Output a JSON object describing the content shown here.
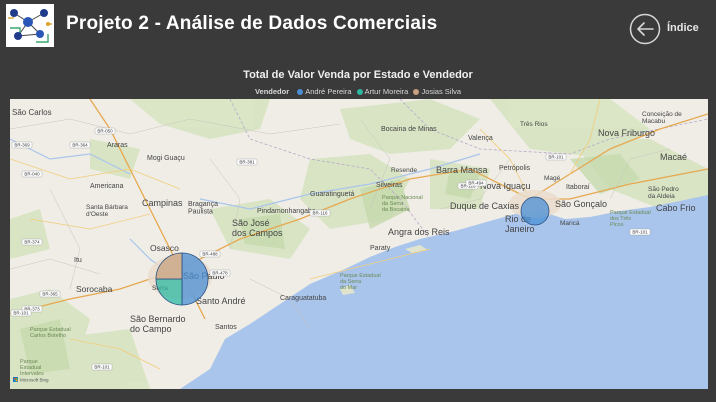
{
  "header": {
    "title": "Projeto 2 - Análise de Dados Comerciais",
    "back_label": "Índice"
  },
  "chart_data": {
    "type": "map",
    "title": "Total de Valor Venda por Estado e Vendedor",
    "legend_title": "Vendedor",
    "legend_placement": "top-center",
    "series": [
      {
        "name": "André Pereira",
        "color": "#4a8fd6"
      },
      {
        "name": "Artur Moreira",
        "color": "#2eb8a3"
      },
      {
        "name": "Josias Silva",
        "color": "#c8a27f"
      }
    ],
    "markers": [
      {
        "location": "São Paulo",
        "shares": [
          0.5,
          0.25,
          0.25
        ]
      },
      {
        "location": "Rio de Janeiro",
        "shares": [
          1.0,
          0,
          0
        ]
      }
    ]
  },
  "map": {
    "attribution": "Microsoft Bing",
    "places": {
      "sao_carlos": "São Carlos",
      "araras": "Araras",
      "mogi_guacu": "Mogi Guaçu",
      "americana": "Americana",
      "santa_barbara": "Santa Bárbara d'Oeste",
      "campinas": "Campinas",
      "braganca": "Bragança Paulista",
      "sao_jose": "São José dos Campos",
      "pindamonhangaba": "Pindamonhangaba",
      "guaratingueta": "Guaratinguetá",
      "silveiras": "Silveiras",
      "bocaina": "Bocaina de Minas",
      "valenca": "Valença",
      "tres_rios": "Três Rios",
      "nova_friburgo": "Nova Friburgo",
      "conceicao": "Conceição de Macabu",
      "resende": "Resende",
      "barra_mansa": "Barra Mansa",
      "petropolis": "Petrópolis",
      "nova_iguacu": "Nova Iguaçu",
      "itaborai": "Itaboraí",
      "macae": "Macaé",
      "sao_pedro": "São Pedro da Aldeia",
      "cabo_frio": "Cabo Frio",
      "duque": "Duque de Caxias",
      "sao_goncalo": "São Gonçalo",
      "rio": "Rio de Janeiro",
      "marica": "Maricá",
      "mage": "Magé",
      "angra": "Angra dos Reis",
      "paraty": "Paraty",
      "caraguatatuba": "Caraguatatuba",
      "sao_paulo": "São Paulo",
      "osasco": "Osasco",
      "santo_andre": "Santo André",
      "sao_bernardo": "São Bernardo do Campo",
      "santos": "Santos",
      "sorocaba": "Sorocaba",
      "itu": "Itu",
      "serra": "Serra",
      "park1": "Parque Estadual da Serra do Mar",
      "park2": "Parque Nacional da Serra da Bocaina",
      "park3": "Parque Estadual Carlos Botelho",
      "park4": "Parque Estadual Intervales",
      "park5": "Parque Estadual dos Três Picos"
    },
    "roads": [
      "BR-050",
      "BR-369",
      "BR-364",
      "BR-040",
      "BR-381",
      "BR-116",
      "BR-116",
      "BR-494",
      "BR-101",
      "BR-101",
      "BR-374",
      "BR-373",
      "BR-478",
      "BR-101",
      "BR-365",
      "BR-101",
      "BR-488"
    ]
  }
}
